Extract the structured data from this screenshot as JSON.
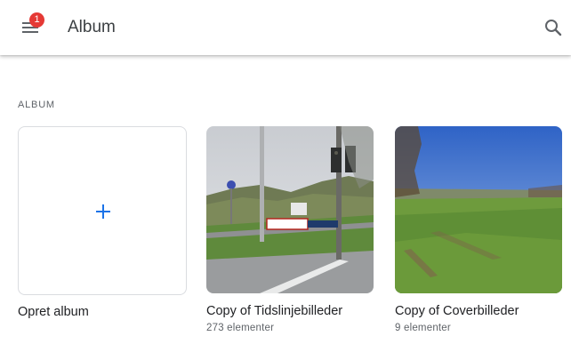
{
  "header": {
    "title": "Album",
    "notification_count": "1",
    "menu_icon": "hamburger-menu-icon",
    "search_icon": "search-icon"
  },
  "section": {
    "label": "ALBUM"
  },
  "create_album": {
    "label": "Opret album",
    "icon": "plus-icon",
    "accent": "#1a73e8"
  },
  "albums": [
    {
      "title": "Copy of Tidslinjebilleder",
      "count": "273 elementer"
    },
    {
      "title": "Copy of Coverbilleder",
      "count": "9 elementer"
    }
  ],
  "colors": {
    "badge": "#e53935",
    "accent": "#1a73e8"
  }
}
